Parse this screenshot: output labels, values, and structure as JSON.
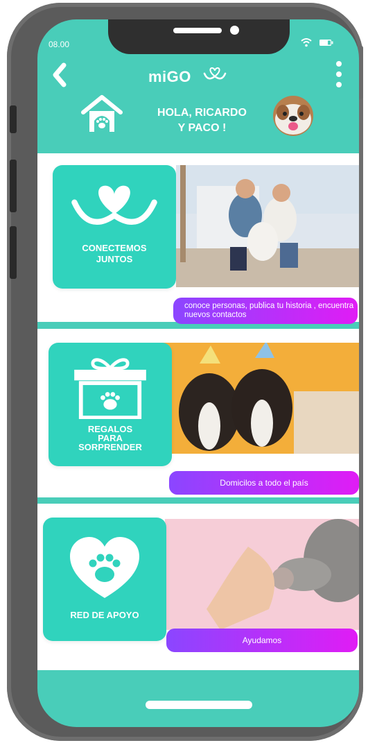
{
  "status": {
    "time": "08.00"
  },
  "header": {
    "title": "miGO",
    "greeting_line1": "HOLA, RICARDO",
    "greeting_line2": "Y PACO !"
  },
  "cards": [
    {
      "title_line1": "CONECTEMOS",
      "title_line2": "JUNTOS",
      "caption": "conoce personas, publica tu historia , encuentra nuevos contactos"
    },
    {
      "title_line1": "REGALOS",
      "title_line2": "PARA",
      "title_line3": "SORPRENDER",
      "caption": "Domicilos a todo el país"
    },
    {
      "title_line1": "RED DE APOYO",
      "caption": "Ayudamos"
    }
  ],
  "colors": {
    "screen_teal": "#49cdb9",
    "tile_teal": "#30d3bd",
    "pill_gradient_start": "#8b46ff",
    "pill_gradient_end": "#e01cf5",
    "phone_body": "#5b5b5b"
  },
  "icons": [
    "back-icon",
    "heart-smile-logo-icon",
    "menu-icon",
    "dog-house-icon",
    "gift-box-icon",
    "paw-heart-icon",
    "wifi-icon",
    "battery-icon"
  ]
}
